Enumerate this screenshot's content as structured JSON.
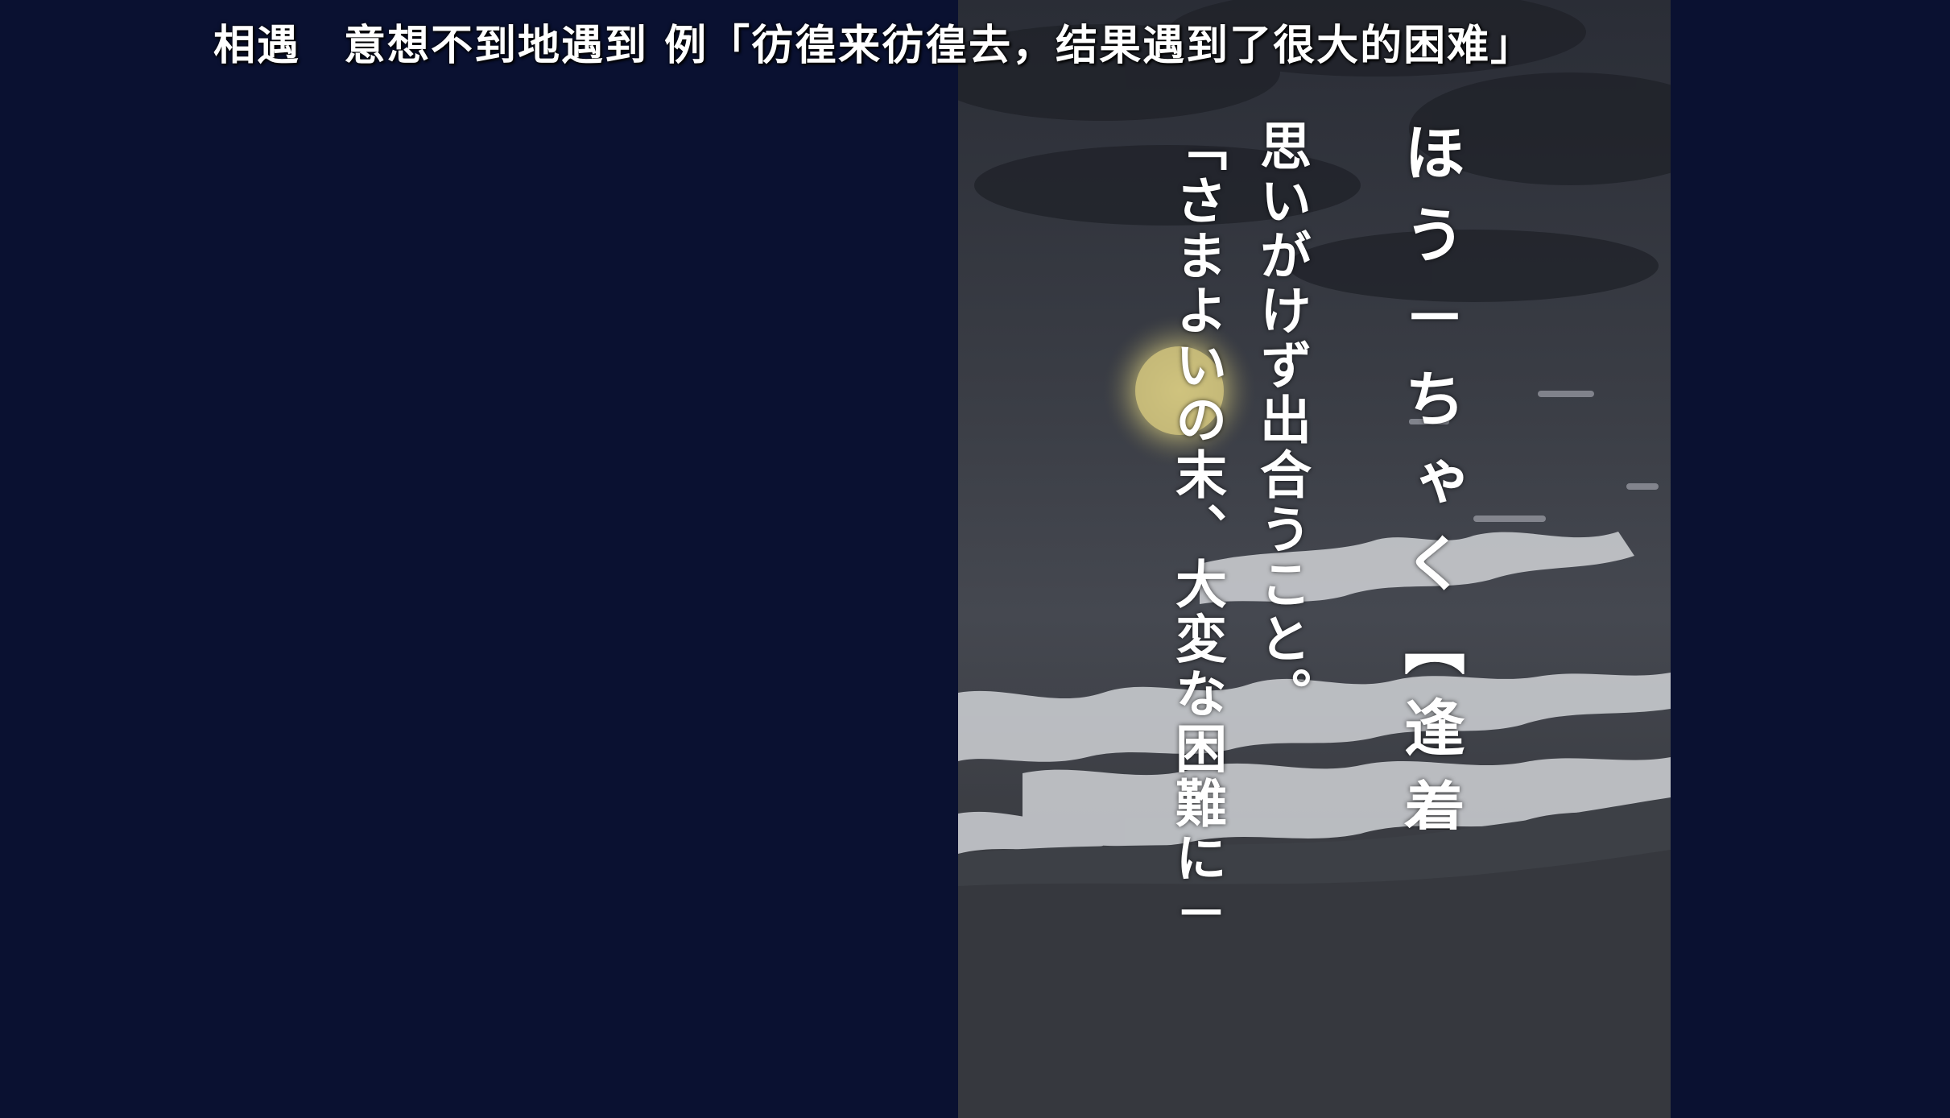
{
  "subtitle": {
    "text": "相遇　意想不到地遇到 例「彷徨来彷徨去，结果遇到了很大的困难」"
  },
  "entry": {
    "reading": "ほう－ちゃく【逢着",
    "definition": "思いがけず出合うこと。",
    "example": "「さまよいの末、大変な困難に－"
  },
  "colors": {
    "background": "#0a1131",
    "text": "#ffffff",
    "moon": "#d8cf8a"
  }
}
